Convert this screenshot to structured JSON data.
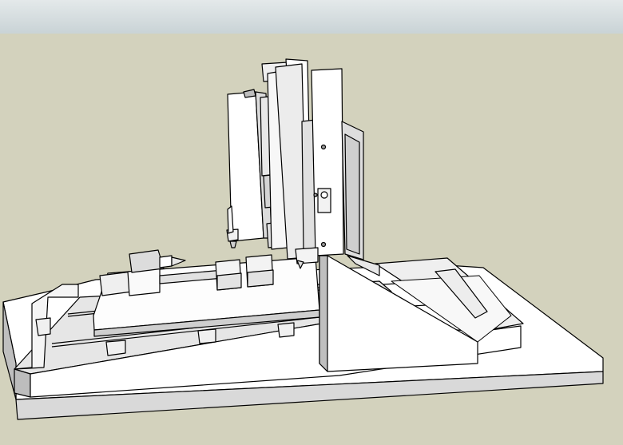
{
  "scene": {
    "sky_color": "#dfe5e6",
    "ground_color": "#d3d2bd",
    "model_fill": "#ffffff",
    "model_shade": "#d8d8d8",
    "edge_color": "#000000"
  }
}
